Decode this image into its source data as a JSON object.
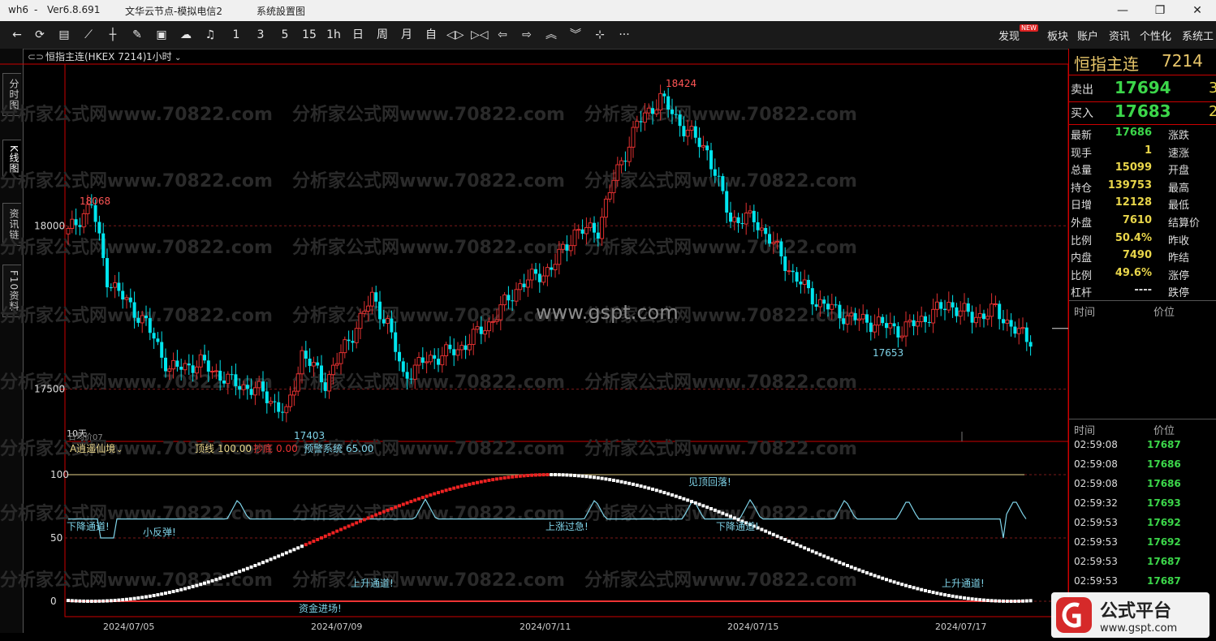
{
  "titlebar": {
    "app": "wh6",
    "dash": "-",
    "version": "Ver6.8.691",
    "server": "文华云节点-模拟电信2",
    "menu": "系统設置图"
  },
  "toolbar": {
    "periods": [
      "1",
      "3",
      "5",
      "15",
      "1h",
      "日",
      "周",
      "月",
      "自"
    ],
    "right_menu": [
      "发现",
      "板块",
      "账户",
      "资讯",
      "个性化",
      "系统工"
    ],
    "new_badge": "NEW",
    "more": "···"
  },
  "side_tabs": [
    "分时图",
    "K线图",
    "资讯链",
    "F10资料"
  ],
  "chart_header": {
    "symbol": "恒指主连(HKEX 7214)",
    "period": "1小时"
  },
  "main_chart": {
    "y_ticks": [
      "18000",
      "17500"
    ],
    "labels": {
      "high": "18424",
      "left_high": "18068",
      "low_left": "17403",
      "low_right": "17653"
    },
    "corner_label": "10天",
    "corner_label2": "日均价07"
  },
  "indicator": {
    "name": "A逍遥仙境",
    "params": [
      {
        "label": "顶线",
        "value": "100.00",
        "color": "#e8d58a"
      },
      {
        "label": "抄底",
        "value": "0.00",
        "color": "#e33"
      },
      {
        "label": "预警系统",
        "value": "65.00",
        "color": "#7fd3e8"
      }
    ],
    "y_ticks": [
      "100",
      "50",
      "0"
    ],
    "annotations": [
      "下降通道!",
      "小反弹!",
      "见顶回落!",
      "上涨过急!",
      "下降通道!",
      "上升通道!",
      "资金进场!",
      "上升通道!"
    ]
  },
  "x_axis": [
    "2024/07/05",
    "2024/07/09",
    "2024/07/11",
    "2024/07/15",
    "2024/07/17"
  ],
  "watermarks": {
    "site": "分析家公式网www.70822.com",
    "center": "www.gspt.com"
  },
  "quote": {
    "name": "恒指主连",
    "code": "7214",
    "sell_label": "卖出",
    "sell": "17694",
    "sell_vol": "3",
    "buy_label": "买入",
    "buy": "17683",
    "buy_vol": "2",
    "rows": [
      {
        "l": "最新",
        "v": "17686",
        "c": "#3cd64a",
        "r": "涨跌"
      },
      {
        "l": "现手",
        "v": "1",
        "c": "#e8d54a",
        "r": "速涨"
      },
      {
        "l": "总量",
        "v": "15099",
        "c": "#e8d54a",
        "r": "开盘"
      },
      {
        "l": "持仓",
        "v": "139753",
        "c": "#e8d54a",
        "r": "最高"
      },
      {
        "l": "日增",
        "v": "12128",
        "c": "#e8d54a",
        "r": "最低"
      },
      {
        "l": "外盘",
        "v": "7610",
        "c": "#e8d54a",
        "r": "结算价"
      },
      {
        "l": "比例",
        "v": "50.4%",
        "c": "#e8d54a",
        "r": "昨收"
      },
      {
        "l": "内盘",
        "v": "7490",
        "c": "#e8d54a",
        "r": "昨结"
      },
      {
        "l": "比例",
        "v": "49.6%",
        "c": "#e8d54a",
        "r": "涨停"
      },
      {
        "l": "杠杆",
        "v": "----",
        "c": "#ddd",
        "r": "跌停"
      }
    ],
    "time_header": "时间",
    "price_header": "价位",
    "ticks": [
      {
        "t": "02:59:08",
        "p": "17687"
      },
      {
        "t": "02:59:08",
        "p": "17686"
      },
      {
        "t": "02:59:08",
        "p": "17686"
      },
      {
        "t": "02:59:32",
        "p": "17693"
      },
      {
        "t": "02:59:53",
        "p": "17692"
      },
      {
        "t": "02:59:53",
        "p": "17692"
      },
      {
        "t": "02:59:53",
        "p": "17687"
      },
      {
        "t": "02:59:53",
        "p": "17687"
      }
    ]
  },
  "logo": {
    "text": "公式平台",
    "url_text": "www.gspt.com"
  }
}
